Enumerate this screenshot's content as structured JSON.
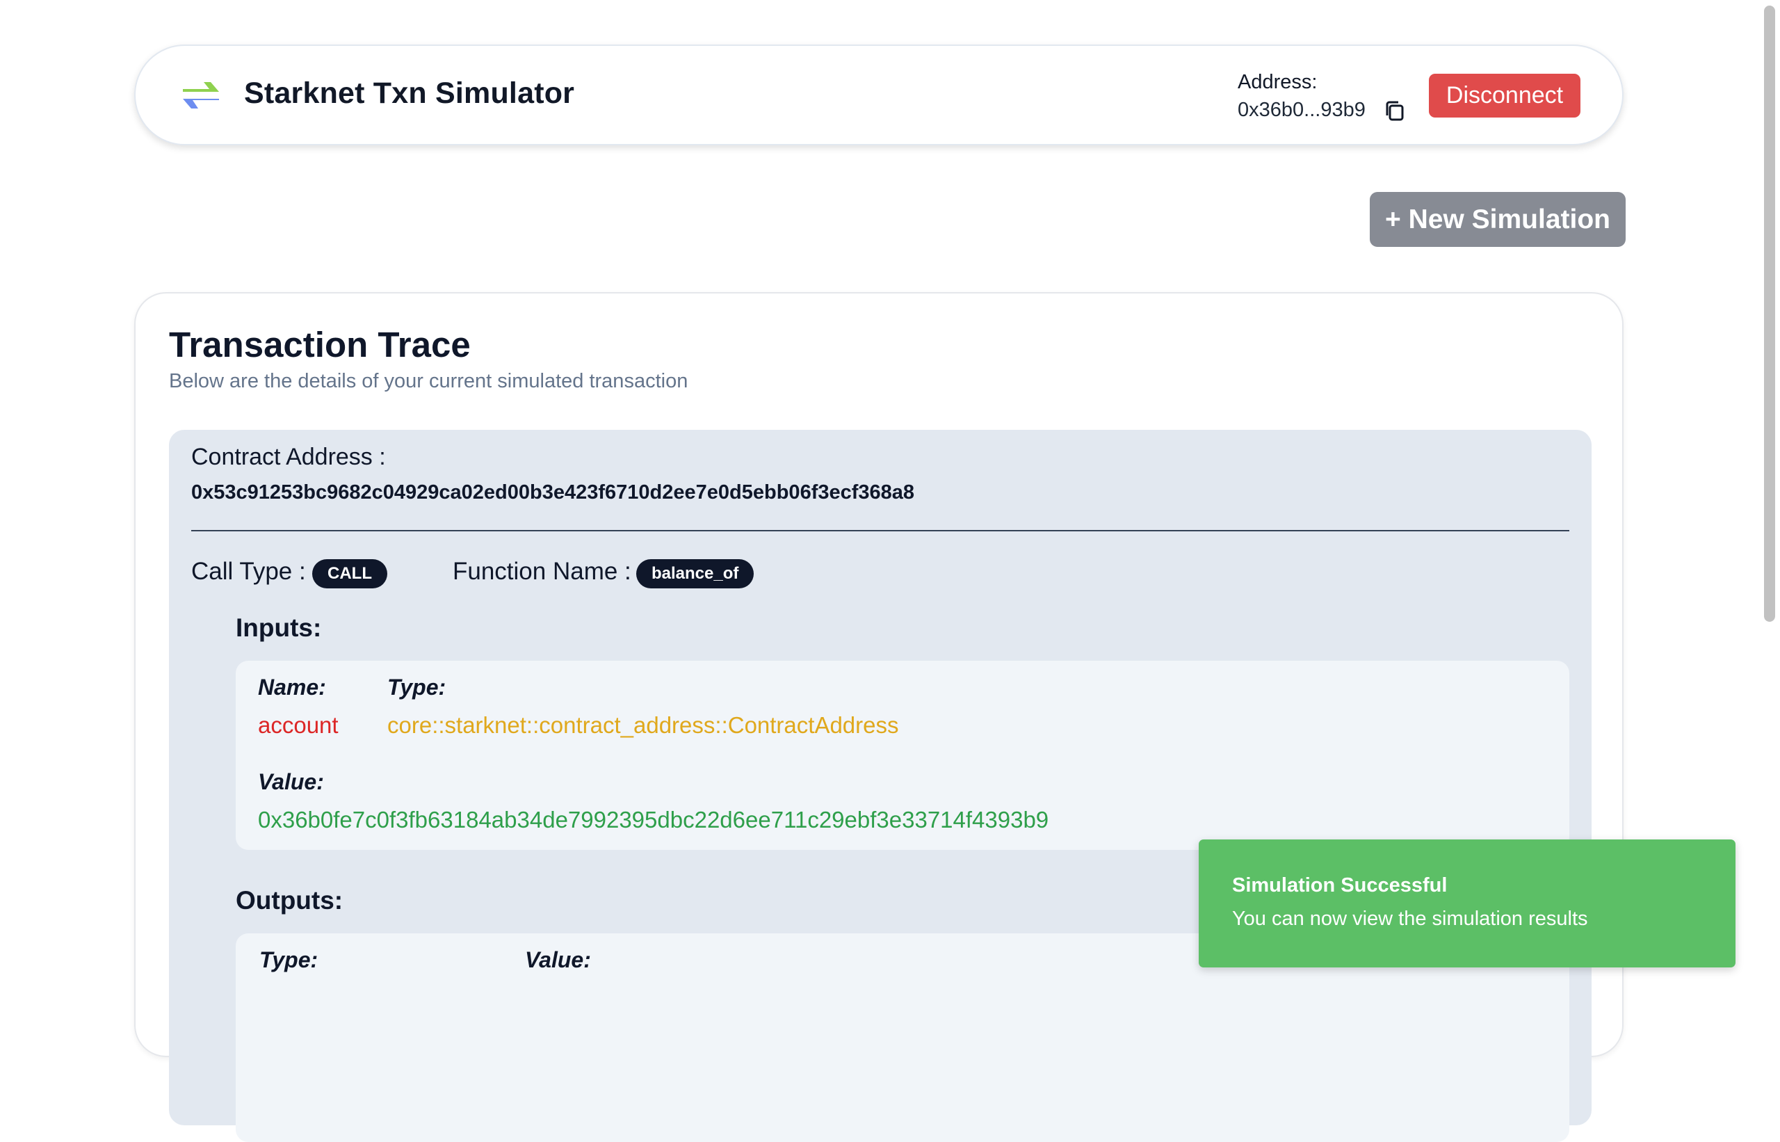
{
  "header": {
    "title": "Starknet Txn Simulator",
    "address_label": "Address:",
    "address_value": "0x36b0...93b9",
    "disconnect_label": "Disconnect",
    "icons": [
      "swap-arrows-icon",
      "copy-icon"
    ]
  },
  "actions": {
    "new_simulation_label": "+ New Simulation"
  },
  "trace": {
    "title": "Transaction Trace",
    "subtitle": "Below are the details of your current simulated transaction",
    "contract_address_label": "Contract Address :",
    "contract_address": "0x53c91253bc9682c04929ca02ed00b3e423f6710d2ee7e0d5ebb06f3ecf368a8",
    "call_type_label": "Call Type :",
    "call_type": "CALL",
    "function_name_label": "Function Name :",
    "function_name": "balance_of",
    "inputs": {
      "title": "Inputs:",
      "name_header": "Name:",
      "type_header": "Type:",
      "value_header": "Value:",
      "name": "account",
      "type": "core::starknet::contract_address::ContractAddress",
      "value": "0x36b0fe7c0f3fb63184ab34de7992395dbc22d6ee711c29ebf3e33714f4393b9"
    },
    "outputs": {
      "title": "Outputs:",
      "type_header": "Type:",
      "value_header": "Value:"
    }
  },
  "toast": {
    "title": "Simulation Successful",
    "description": "You can now view the simulation results"
  },
  "colors": {
    "disconnect": "#e04b4b",
    "new_simulation": "#878b94",
    "toast": "#5cbf66",
    "input_name": "#dc2626",
    "input_type": "#e0a81c",
    "input_value": "#2e9f4a"
  }
}
